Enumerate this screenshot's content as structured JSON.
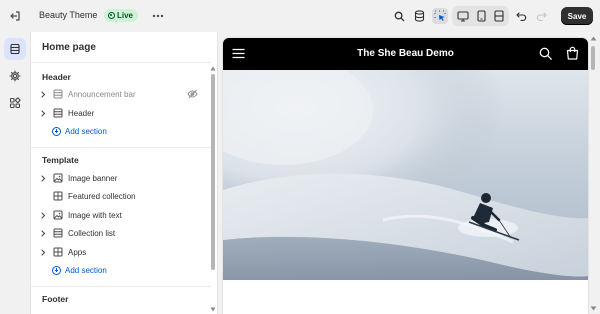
{
  "topbar": {
    "theme_name": "Beauty Theme",
    "status_badge": "Live",
    "save_label": "Save"
  },
  "rail": {
    "items": [
      {
        "icon": "sections-icon",
        "active": true
      },
      {
        "icon": "gear-icon",
        "active": false
      },
      {
        "icon": "apps-icon",
        "active": false
      }
    ]
  },
  "sidebar": {
    "title": "Home page",
    "header_group": {
      "label": "Header",
      "items": [
        {
          "label": "Announcement bar",
          "icon": "section-icon",
          "hidden": true
        },
        {
          "label": "Header",
          "icon": "section-icon",
          "hidden": false
        }
      ],
      "add_label": "Add section"
    },
    "template_group": {
      "label": "Template",
      "items": [
        {
          "label": "Image banner",
          "icon": "image-icon"
        },
        {
          "label": "Featured collection",
          "icon": "grid-icon"
        },
        {
          "label": "Image with text",
          "icon": "image-icon"
        },
        {
          "label": "Collection list",
          "icon": "section-icon"
        },
        {
          "label": "Apps",
          "icon": "grid-icon"
        }
      ],
      "add_label": "Add section"
    },
    "footer_group": {
      "label": "Footer"
    }
  },
  "preview": {
    "store_title": "The She Beau Demo",
    "banner_image": "skier in snow powder",
    "colors": {
      "store_header_bg": "#000000",
      "accent": "#005bd3",
      "live_badge_bg": "#cdf3d3"
    }
  }
}
